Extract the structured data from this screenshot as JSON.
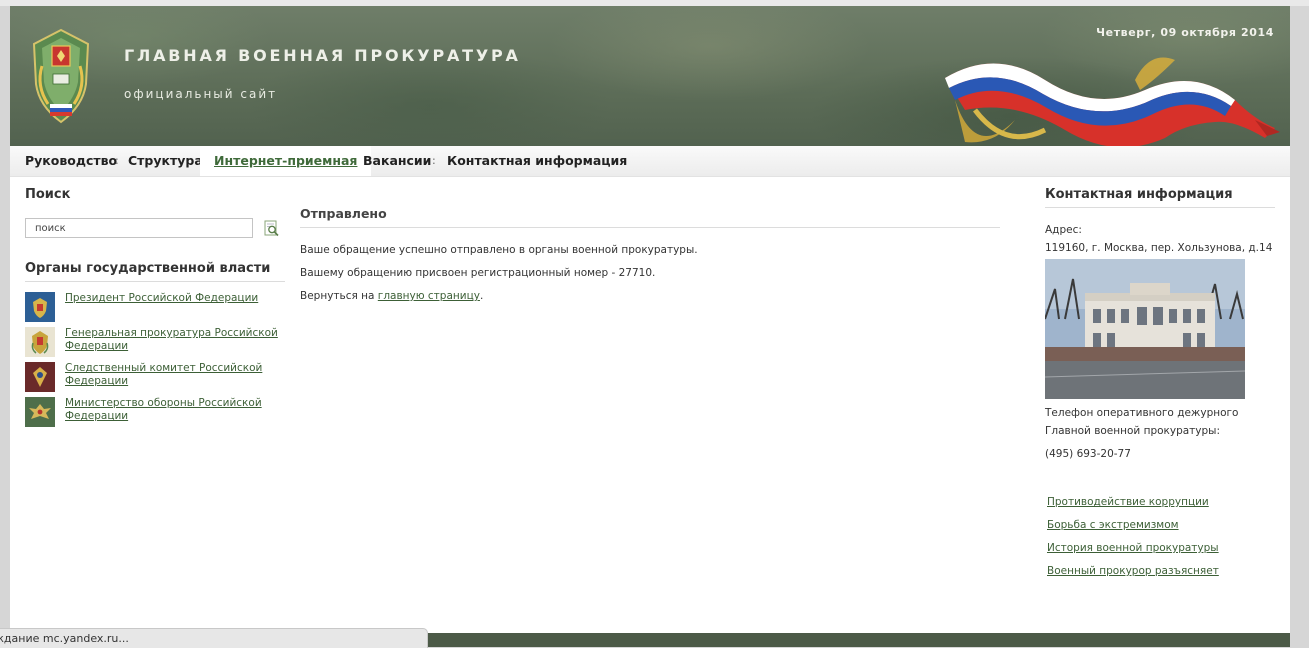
{
  "header": {
    "title": "ГЛАВНАЯ ВОЕННАЯ ПРОКУРАТУРА",
    "subtitle": "официальный сайт",
    "date": "Четверг, 09 октября 2014"
  },
  "nav": {
    "items": [
      {
        "label": "Руководство"
      },
      {
        "label": "Структура"
      },
      {
        "label": "Интернет-приемная",
        "active": true
      },
      {
        "label": "Вакансии"
      },
      {
        "label": "Контактная информация"
      }
    ],
    "separator": ":"
  },
  "left": {
    "search_title": "Поиск",
    "search_value": "поиск",
    "orgs_title": "Органы государственной власти",
    "orgs": [
      {
        "label": "Президент Российской Федерации"
      },
      {
        "label": "Генеральная прокуратура Российской Федерации"
      },
      {
        "label": "Следственный комитет Российской Федерации"
      },
      {
        "label": "Министерство обороны Российской Федерации"
      }
    ]
  },
  "main": {
    "title": "Отправлено",
    "line1": "Ваше обращение успешно отправлено в органы военной прокуратуры.",
    "line2": "Вашему обращению присвоен регистрационный номер - 27710.",
    "line3_prefix": "Вернуться на",
    "line3_link": "главную страницу",
    "line3_suffix": "."
  },
  "right": {
    "title": "Контактная информация",
    "address_label": "Адрес:",
    "address": "119160, г. Москва, пер. Хользунова, д.14",
    "phone_label_1": "Телефон оперативного дежурного",
    "phone_label_2": "Главной военной прокуратуры:",
    "phone": "(495) 693-20-77",
    "links": [
      {
        "label": "Противодействие коррупции"
      },
      {
        "label": "Борьба с экстремизмом"
      },
      {
        "label": "История военной прокуратуры"
      },
      {
        "label": "Военный прокурор разъясняет"
      }
    ]
  },
  "status_bar": {
    "text": "ждание mc.yandex.ru..."
  },
  "colors": {
    "header_green": "#5d6d58",
    "link_green": "#3c5f36",
    "footer_green": "#4c5a47"
  }
}
